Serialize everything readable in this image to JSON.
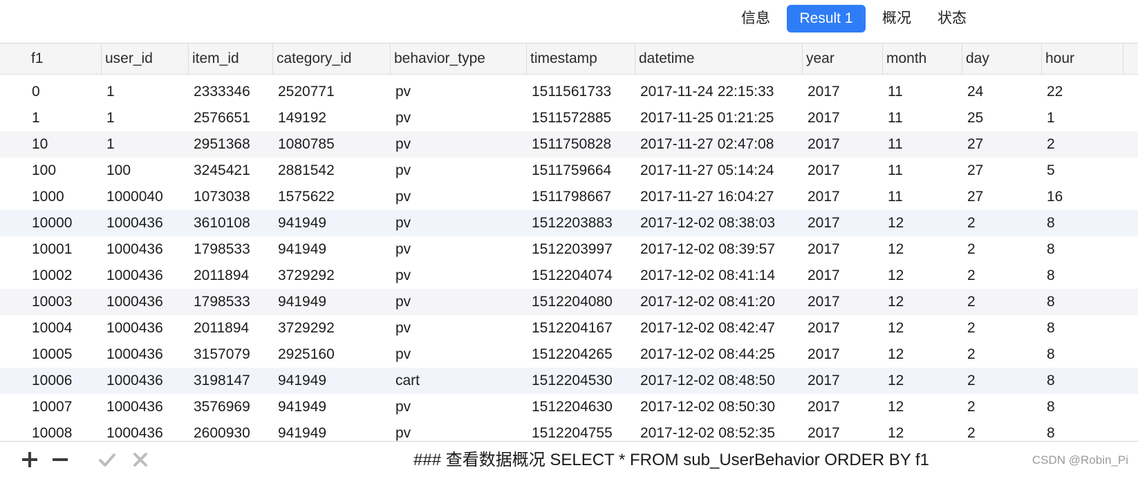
{
  "tabs": [
    {
      "label": "信息",
      "active": false
    },
    {
      "label": "Result 1",
      "active": true
    },
    {
      "label": "概况",
      "active": false
    },
    {
      "label": "状态",
      "active": false
    }
  ],
  "colors": {
    "accent": "#2f7df6",
    "header_bg": "#f5f5f5",
    "alt_row": "#f5f5f7",
    "tint_row": "#f1f5fb"
  },
  "table": {
    "columns": [
      "f1",
      "user_id",
      "item_id",
      "category_id",
      "behavior_type",
      "timestamp",
      "datetime",
      "year",
      "month",
      "day",
      "hour"
    ],
    "rows": [
      [
        "0",
        "1",
        "2333346",
        "2520771",
        "pv",
        "1511561733",
        "2017-11-24 22:15:33",
        "2017",
        "11",
        "24",
        "22"
      ],
      [
        "1",
        "1",
        "2576651",
        "149192",
        "pv",
        "1511572885",
        "2017-11-25 01:21:25",
        "2017",
        "11",
        "25",
        "1"
      ],
      [
        "10",
        "1",
        "2951368",
        "1080785",
        "pv",
        "1511750828",
        "2017-11-27 02:47:08",
        "2017",
        "11",
        "27",
        "2"
      ],
      [
        "100",
        "100",
        "3245421",
        "2881542",
        "pv",
        "1511759664",
        "2017-11-27 05:14:24",
        "2017",
        "11",
        "27",
        "5"
      ],
      [
        "1000",
        "1000040",
        "1073038",
        "1575622",
        "pv",
        "1511798667",
        "2017-11-27 16:04:27",
        "2017",
        "11",
        "27",
        "16"
      ],
      [
        "10000",
        "1000436",
        "3610108",
        "941949",
        "pv",
        "1512203883",
        "2017-12-02 08:38:03",
        "2017",
        "12",
        "2",
        "8"
      ],
      [
        "10001",
        "1000436",
        "1798533",
        "941949",
        "pv",
        "1512203997",
        "2017-12-02 08:39:57",
        "2017",
        "12",
        "2",
        "8"
      ],
      [
        "10002",
        "1000436",
        "2011894",
        "3729292",
        "pv",
        "1512204074",
        "2017-12-02 08:41:14",
        "2017",
        "12",
        "2",
        "8"
      ],
      [
        "10003",
        "1000436",
        "1798533",
        "941949",
        "pv",
        "1512204080",
        "2017-12-02 08:41:20",
        "2017",
        "12",
        "2",
        "8"
      ],
      [
        "10004",
        "1000436",
        "2011894",
        "3729292",
        "pv",
        "1512204167",
        "2017-12-02 08:42:47",
        "2017",
        "12",
        "2",
        "8"
      ],
      [
        "10005",
        "1000436",
        "3157079",
        "2925160",
        "pv",
        "1512204265",
        "2017-12-02 08:44:25",
        "2017",
        "12",
        "2",
        "8"
      ],
      [
        "10006",
        "1000436",
        "3198147",
        "941949",
        "cart",
        "1512204530",
        "2017-12-02 08:48:50",
        "2017",
        "12",
        "2",
        "8"
      ],
      [
        "10007",
        "1000436",
        "3576969",
        "941949",
        "pv",
        "1512204630",
        "2017-12-02 08:50:30",
        "2017",
        "12",
        "2",
        "8"
      ],
      [
        "10008",
        "1000436",
        "2600930",
        "941949",
        "pv",
        "1512204755",
        "2017-12-02 08:52:35",
        "2017",
        "12",
        "2",
        "8"
      ]
    ]
  },
  "footer": {
    "tools": [
      {
        "icon": "plus-icon",
        "name": "add-row-button"
      },
      {
        "icon": "minus-icon",
        "name": "delete-row-button"
      },
      {
        "icon": "checkmark-icon",
        "name": "apply-button"
      },
      {
        "icon": "close-icon",
        "name": "discard-button"
      }
    ],
    "query": "### 查看数据概况 SELECT * FROM sub_UserBehavior ORDER BY f1",
    "watermark": "CSDN @Robin_Pi"
  }
}
